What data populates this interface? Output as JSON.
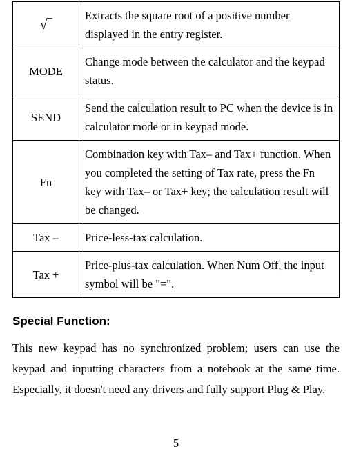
{
  "table": {
    "rows": [
      {
        "key": "√‾",
        "desc": "Extracts the square root of a positive number displayed in the entry register."
      },
      {
        "key": "MODE",
        "desc": "Change mode between the calculator and the keypad status."
      },
      {
        "key": "SEND",
        "desc": "Send the calculation result to PC when the device is in calculator mode or in keypad mode."
      },
      {
        "key": "Fn",
        "desc": "Combination key with Tax– and Tax+ function. When you completed the setting of Tax rate, press the Fn key with Tax– or Tax+ key; the calculation result will be changed."
      },
      {
        "key": "Tax –",
        "desc": "Price-less-tax calculation."
      },
      {
        "key": "Tax +",
        "desc": "Price-plus-tax calculation. When Num Off, the input symbol will be \"=\"."
      }
    ]
  },
  "section": {
    "heading": "Special Function:",
    "paragraph": "This new keypad has no synchronized problem; users can use the keypad and inputting characters from a notebook at the same time. Especially, it doesn't need any drivers and fully support Plug & Play."
  },
  "page_number": "5"
}
